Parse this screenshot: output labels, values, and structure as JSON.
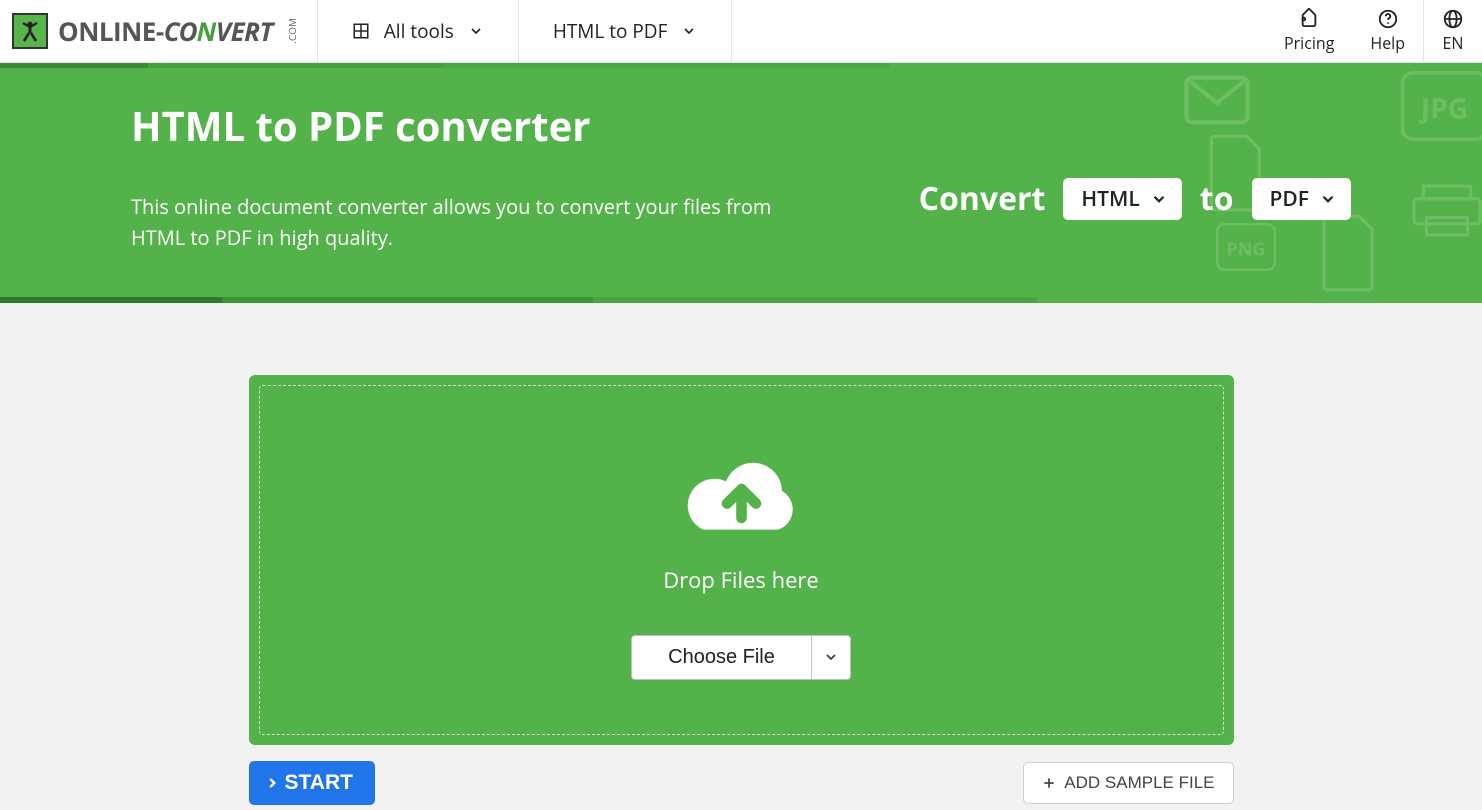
{
  "brand": {
    "name1": "ONLINE",
    "dash": "-",
    "name2a": "CO",
    "name2b": "N",
    "name2c": "VERT",
    "tld": ".COM"
  },
  "nav": {
    "all_tools": "All tools",
    "current": "HTML to PDF",
    "pricing": "Pricing",
    "help": "Help",
    "lang": "EN"
  },
  "hero": {
    "title": "HTML to PDF converter",
    "desc": "This online document converter allows you to convert your files from HTML to PDF in high quality.",
    "convert_label": "Convert",
    "from": "HTML",
    "to_label": "to",
    "to": "PDF"
  },
  "drop": {
    "text": "Drop Files here",
    "choose": "Choose File"
  },
  "actions": {
    "start": "START",
    "sample": "ADD SAMPLE FILE"
  }
}
